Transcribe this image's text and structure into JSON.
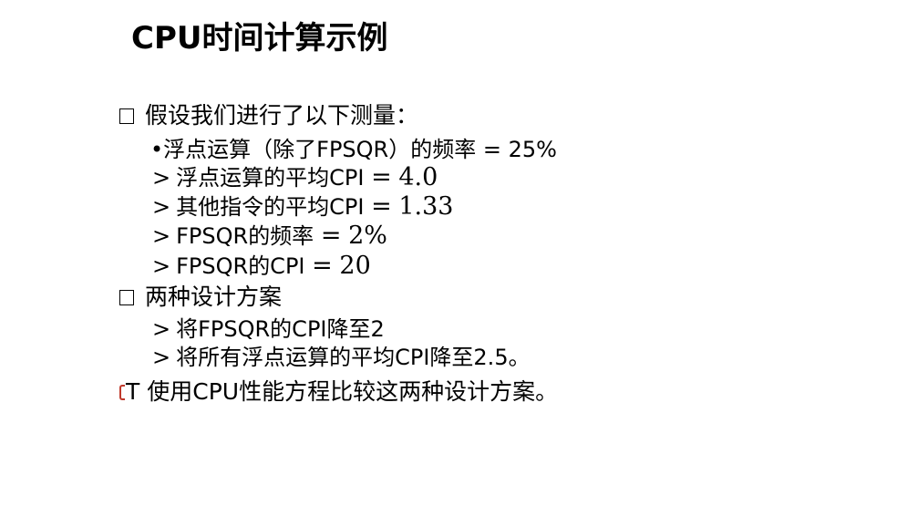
{
  "title": "CPU时间计算示例",
  "bullets": [
    {
      "text": "假设我们进行了以下测量："
    },
    {
      "text": "•浮点运算（除了FPSQR）的频率 = 25%"
    },
    {
      "text": "浮点运算的平均CPI",
      "eq": "=",
      "value": "4.0"
    },
    {
      "text": "其他指令的平均CPI",
      "eq": "=",
      "value": "1.33"
    },
    {
      "text": "FPSQR的频率",
      "eq": "=",
      "value": "2%"
    },
    {
      "text": "FPSQR的CPI",
      "eq": "=",
      "value": "20"
    },
    {
      "text": "两种设计方案"
    },
    {
      "text": "将FPSQR的CPI降至2"
    },
    {
      "text": "将所有浮点运算的平均CPI降至2.5。"
    },
    {
      "prefix": "T",
      "text": "使用CPU性能方程比较这两种设计方案。"
    }
  ],
  "symbols": {
    "gt": ">"
  },
  "colors": {
    "text": "#000000",
    "marker": "#c0392b",
    "background": "#ffffff"
  }
}
